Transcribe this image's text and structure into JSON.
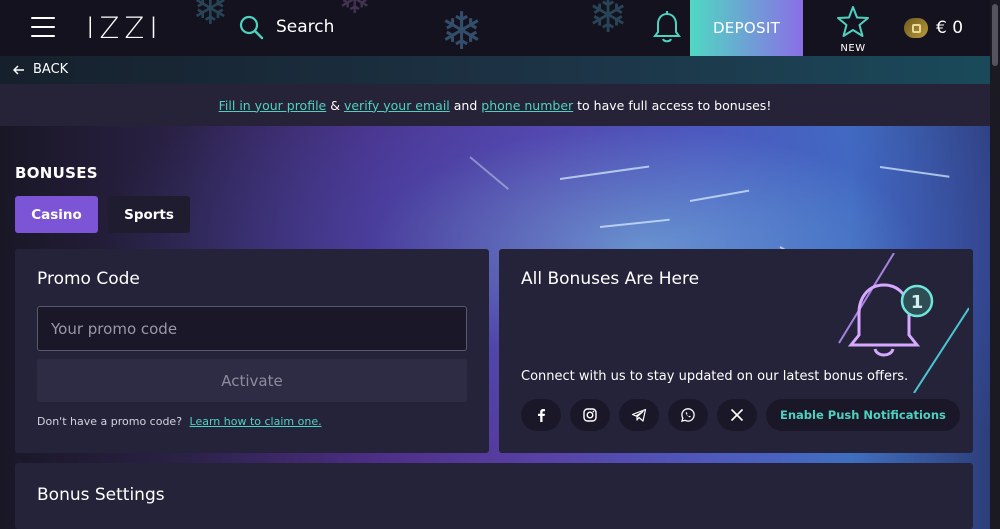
{
  "header": {
    "logo": "IZZI",
    "search_label": "Search",
    "deposit_label": "DEPOSIT",
    "new_label": "NEW",
    "balance": "€ 0"
  },
  "back": {
    "label": "BACK"
  },
  "notice": {
    "link_profile": "Fill in your profile",
    "amp": "&",
    "link_email": "verify your email",
    "and": "and",
    "link_phone": "phone number",
    "suffix": "to have full access to bonuses!"
  },
  "bonuses": {
    "title": "BONUSES",
    "tabs": [
      {
        "label": "Casino",
        "active": true
      },
      {
        "label": "Sports",
        "active": false
      }
    ]
  },
  "promo": {
    "title": "Promo Code",
    "input_placeholder": "Your promo code",
    "input_value": "",
    "activate_label": "Activate",
    "hint_text": "Don't have a promo code?",
    "hint_link": "Learn how to claim one."
  },
  "social": {
    "title": "All Bonuses Are Here",
    "bell_badge": "1",
    "text": "Connect with us to stay updated on our latest bonus offers.",
    "buttons": [
      "facebook-icon",
      "instagram-icon",
      "telegram-icon",
      "whatsapp-icon",
      "x-icon"
    ],
    "push_label": "Enable Push Notifications"
  },
  "settings": {
    "title": "Bonus Settings"
  },
  "colors": {
    "accent_teal": "#4fd1c0",
    "accent_purple": "#7b55d6",
    "card_bg": "#25233a",
    "page_bg": "#1a1828"
  }
}
